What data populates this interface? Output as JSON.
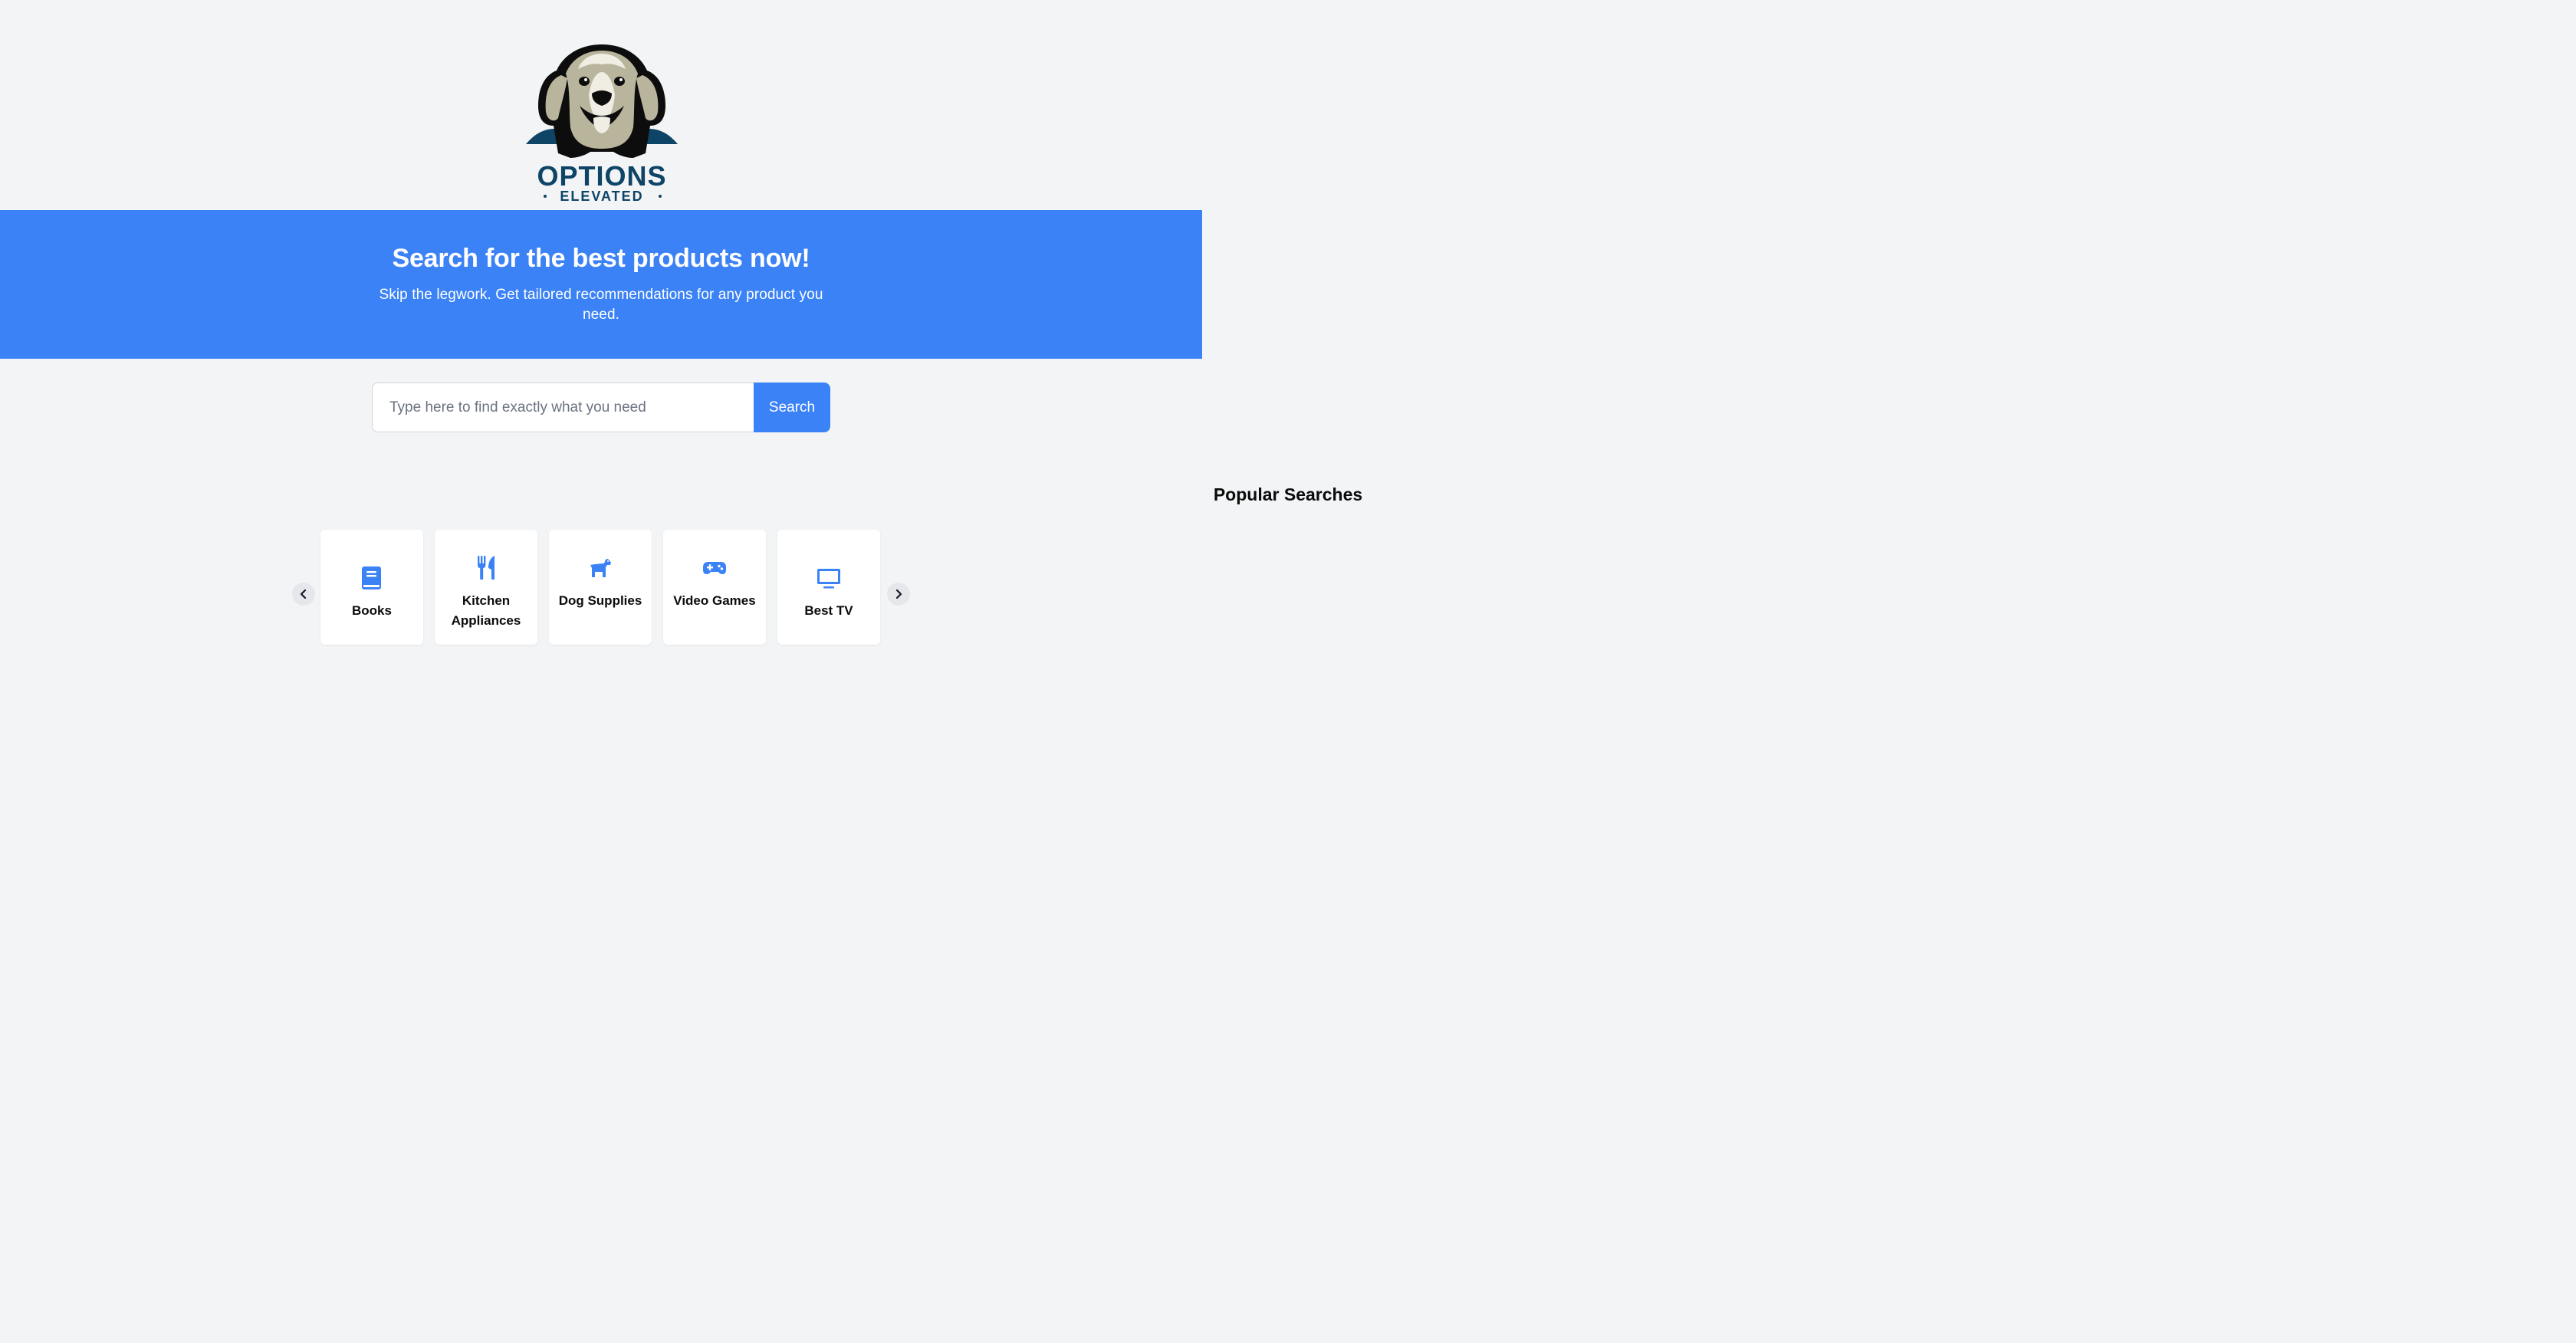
{
  "brand": {
    "logo_name": "OPTIONS",
    "logo_tagline": "ELEVATED",
    "colors": {
      "navy": "#0e4466",
      "fur": "#b9b59c",
      "outline": "#0d0d0d"
    }
  },
  "hero": {
    "title": "Search for the best products now!",
    "subtitle": "Skip the legwork. Get tailored recommendations for any product you need.",
    "background": "#3b82f6"
  },
  "search": {
    "placeholder": "Type here to find exactly what you need",
    "value": "",
    "button_label": "Search"
  },
  "popular": {
    "title": "Popular Searches",
    "items": [
      {
        "label": "Books",
        "icon": "book-icon"
      },
      {
        "label": "Kitchen Appliances",
        "icon": "utensils-icon"
      },
      {
        "label": "Dog Supplies",
        "icon": "dog-icon"
      },
      {
        "label": "Video Games",
        "icon": "gamepad-icon"
      },
      {
        "label": "Best TV",
        "icon": "tv-icon"
      }
    ],
    "prev_icon": "chevron-left-icon",
    "next_icon": "chevron-right-icon"
  },
  "colors": {
    "accent": "#3b82f6",
    "page_bg": "#f3f4f6",
    "card_bg": "#ffffff"
  }
}
